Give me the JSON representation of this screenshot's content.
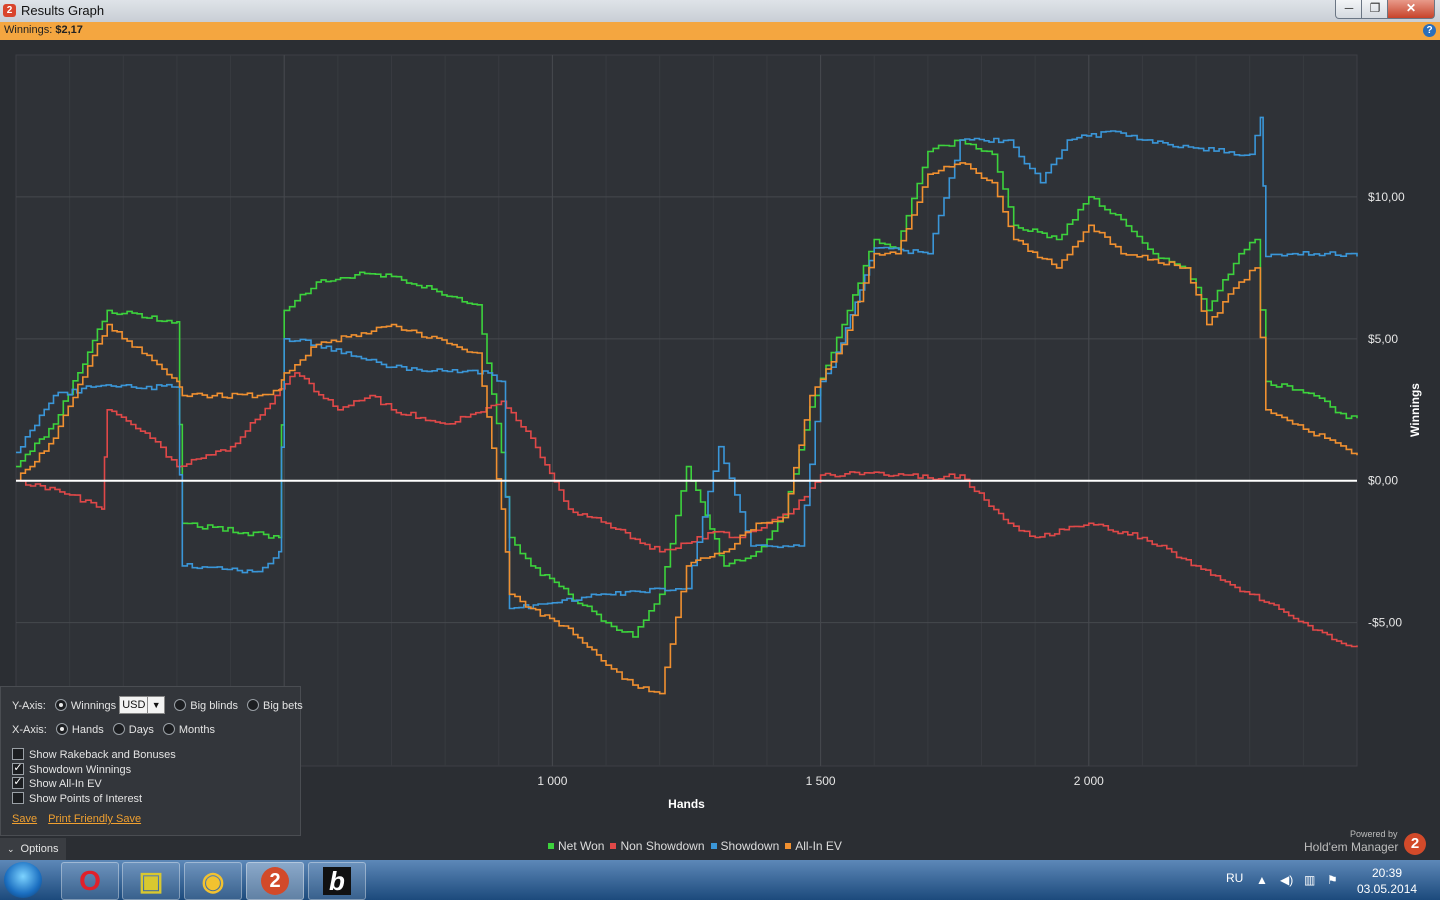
{
  "window": {
    "title": "Results Graph",
    "icon": "hem2-icon",
    "minimize": "─",
    "maximize": "❐",
    "close": "✕"
  },
  "winnings_bar": {
    "label": "Winnings:",
    "value": "$2,17",
    "help": "?"
  },
  "chart_data": {
    "type": "line",
    "xlabel": "Hands",
    "ylabel": "Winnings",
    "xlim": [
      0,
      2500
    ],
    "ylim": [
      -10.05,
      15.0
    ],
    "x_ticks": [
      1000,
      1500,
      2000
    ],
    "x_tick_labels": [
      "1 000",
      "1 500",
      "2 000"
    ],
    "y_ticks": [
      10,
      5,
      0,
      -5
    ],
    "y_tick_labels": [
      "$10,00",
      "$5,00",
      "$0,00",
      "-$5,00"
    ],
    "grid": true,
    "legend": "bottom-center",
    "series": [
      {
        "name": "Net Won",
        "color": "#3cd23c",
        "x": [
          0,
          70,
          170,
          300,
          310,
          490,
          500,
          560,
          650,
          700,
          860,
          905,
          920,
          960,
          1030,
          1100,
          1150,
          1200,
          1250,
          1320,
          1380,
          1430,
          1480,
          1540,
          1600,
          1640,
          1700,
          1760,
          1820,
          1860,
          1940,
          2000,
          2060,
          2120,
          2180,
          2220,
          2280,
          2310,
          2330,
          2380,
          2440,
          2460,
          2480,
          2500
        ],
        "y": [
          0.5,
          2.0,
          6.0,
          5.6,
          -1.5,
          -2.0,
          6.0,
          7.0,
          7.3,
          7.2,
          6.2,
          1.0,
          -2.0,
          -3.0,
          -4.0,
          -5.0,
          -5.5,
          -4.0,
          0.5,
          -3.0,
          -2.5,
          -1.2,
          2.6,
          5.5,
          8.5,
          8.2,
          11.6,
          12.0,
          11.5,
          9.0,
          8.5,
          10.0,
          9.2,
          8.0,
          7.5,
          6.0,
          8.0,
          8.5,
          3.5,
          3.2,
          2.8,
          2.4,
          2.2,
          2.2
        ]
      },
      {
        "name": "Non Showdown",
        "color": "#e04848",
        "x": [
          0,
          100,
          160,
          170,
          250,
          300,
          400,
          520,
          600,
          660,
          700,
          800,
          905,
          960,
          1030,
          1100,
          1200,
          1250,
          1300,
          1350,
          1400,
          1450,
          1500,
          1600,
          1700,
          1760,
          1850,
          1900,
          2000,
          2100,
          2200,
          2300,
          2400,
          2480,
          2500
        ],
        "y": [
          0,
          -0.5,
          -1.0,
          2.5,
          1.5,
          0.5,
          1.2,
          3.8,
          2.5,
          3.0,
          2.5,
          2.0,
          2.8,
          1.5,
          -1.0,
          -1.5,
          -2.5,
          -2.2,
          -1.8,
          -2.0,
          -1.5,
          -1.0,
          0.2,
          0.3,
          0.1,
          0.2,
          -1.5,
          -2.0,
          -1.5,
          -2.0,
          -3.0,
          -4.0,
          -5.0,
          -5.8,
          -5.8
        ]
      },
      {
        "name": "Showdown",
        "color": "#3a96d8",
        "x": [
          0,
          70,
          140,
          300,
          310,
          450,
          490,
          500,
          560,
          700,
          880,
          905,
          920,
          1000,
          1100,
          1200,
          1250,
          1310,
          1340,
          1370,
          1400,
          1430,
          1460,
          1500,
          1520,
          1600,
          1700,
          1760,
          1850,
          1910,
          1960,
          2050,
          2100,
          2300,
          2320,
          2330,
          2380,
          2440,
          2500
        ],
        "y": [
          1.0,
          3.0,
          3.3,
          3.3,
          -3.0,
          -3.2,
          -2.5,
          5.0,
          4.8,
          4.0,
          3.8,
          3.5,
          -4.5,
          -4.3,
          -4.0,
          -3.8,
          -3.8,
          1.2,
          -0.5,
          -2.3,
          -2.3,
          -2.3,
          -2.3,
          3.5,
          4.0,
          8.2,
          8.0,
          12.0,
          12.0,
          10.5,
          12.0,
          12.3,
          12.0,
          11.5,
          12.8,
          7.9,
          8.0,
          8.0,
          7.9
        ]
      },
      {
        "name": "All-In EV",
        "color": "#f09030",
        "x": [
          0,
          70,
          170,
          300,
          310,
          450,
          490,
          500,
          560,
          700,
          860,
          905,
          920,
          960,
          1030,
          1100,
          1150,
          1200,
          1250,
          1320,
          1380,
          1430,
          1480,
          1540,
          1600,
          1640,
          1700,
          1760,
          1820,
          1860,
          1940,
          2000,
          2060,
          2120,
          2180,
          2220,
          2280,
          2310,
          2330,
          2380,
          2440,
          2500
        ],
        "y": [
          0,
          1.5,
          5.5,
          3.5,
          3.0,
          3.0,
          3.2,
          3.8,
          4.8,
          5.5,
          4.5,
          -1.0,
          -4.0,
          -4.5,
          -5.2,
          -6.5,
          -7.2,
          -7.5,
          -3.0,
          -2.5,
          -1.5,
          -1.3,
          3.0,
          4.8,
          8.0,
          8.0,
          10.8,
          11.2,
          10.5,
          8.5,
          7.5,
          9.0,
          8.0,
          7.8,
          7.5,
          5.5,
          7.0,
          7.5,
          2.5,
          2.0,
          1.5,
          0.9
        ]
      }
    ],
    "zero_line_color": "#ffffff"
  },
  "legend": {
    "items": [
      {
        "label": "Net Won",
        "color": "#3cd23c"
      },
      {
        "label": "Non Showdown",
        "color": "#e04848"
      },
      {
        "label": "Showdown",
        "color": "#3a96d8"
      },
      {
        "label": "All-In EV",
        "color": "#f09030"
      }
    ]
  },
  "branding": {
    "powered_by": "Powered by",
    "product": "Hold'em Manager",
    "logo_char": "2"
  },
  "options": {
    "tab_label": "Options",
    "y_axis": {
      "label": "Y-Axis:",
      "winnings": "Winnings",
      "currency": "USD",
      "big_blinds": "Big blinds",
      "big_bets": "Big bets",
      "selected": "Winnings"
    },
    "x_axis": {
      "label": "X-Axis:",
      "hands": "Hands",
      "days": "Days",
      "months": "Months",
      "selected": "Hands"
    },
    "checkboxes": [
      {
        "label": "Show Rakeback and Bonuses",
        "checked": false
      },
      {
        "label": "Showdown Winnings",
        "checked": true
      },
      {
        "label": "Show All-In EV",
        "checked": true
      },
      {
        "label": "Show Points of Interest",
        "checked": false
      }
    ],
    "save": "Save",
    "print_save": "Print Friendly Save"
  },
  "taskbar": {
    "apps": [
      {
        "name": "opera",
        "glyph": "O",
        "color": "#e0202a"
      },
      {
        "name": "app-tile",
        "glyph": "▣",
        "color": "#d8c830"
      },
      {
        "name": "messenger",
        "glyph": "◉",
        "color": "#f2c230"
      },
      {
        "name": "holdem-manager",
        "glyph": "2",
        "color": "#d24a2a"
      },
      {
        "name": "bodog",
        "glyph": "b",
        "color": "#ffffff"
      }
    ],
    "lang": "RU",
    "time": "20:39",
    "date": "03.05.2014"
  }
}
